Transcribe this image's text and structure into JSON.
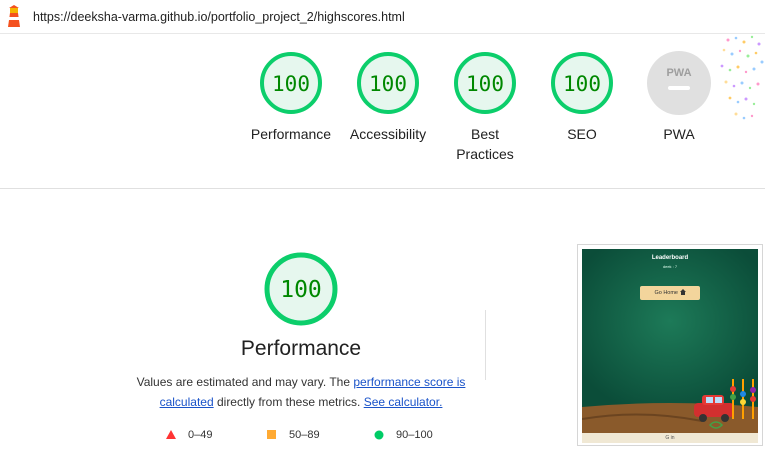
{
  "urlbar": {
    "url": "https://deeksha-varma.github.io/portfolio_project_2/highscores.html"
  },
  "gauges": [
    {
      "score": "100",
      "label_line1": "Performance",
      "label_line2": ""
    },
    {
      "score": "100",
      "label_line1": "Accessibility",
      "label_line2": ""
    },
    {
      "score": "100",
      "label_line1": "Best",
      "label_line2": "Practices"
    },
    {
      "score": "100",
      "label_line1": "SEO",
      "label_line2": ""
    },
    {
      "score": "",
      "badge": "PWA",
      "label_line1": "PWA",
      "label_line2": ""
    }
  ],
  "performance": {
    "score": "100",
    "title": "Performance",
    "desc_prefix": "Values are estimated and may vary. The ",
    "link1": "performance score is calculated",
    "desc_mid": " directly from these metrics. ",
    "link2": "See calculator."
  },
  "legend": [
    {
      "icon": "triangle-icon",
      "color": "#f33",
      "range": "0–49"
    },
    {
      "icon": "square-icon",
      "color": "#fa3",
      "range": "50–89"
    },
    {
      "icon": "circle-icon",
      "color": "#0c6",
      "range": "90–100"
    }
  ],
  "thumbnail": {
    "title": "Leaderboard",
    "subtitle": "deek : 7",
    "button": "Go Home",
    "footer": "G in"
  },
  "colors": {
    "pass": "#0cce6b",
    "pass_fill": "#e6f7ee",
    "pass_text": "#008800",
    "na": "#e0e0e0",
    "link": "#1a53c9"
  }
}
